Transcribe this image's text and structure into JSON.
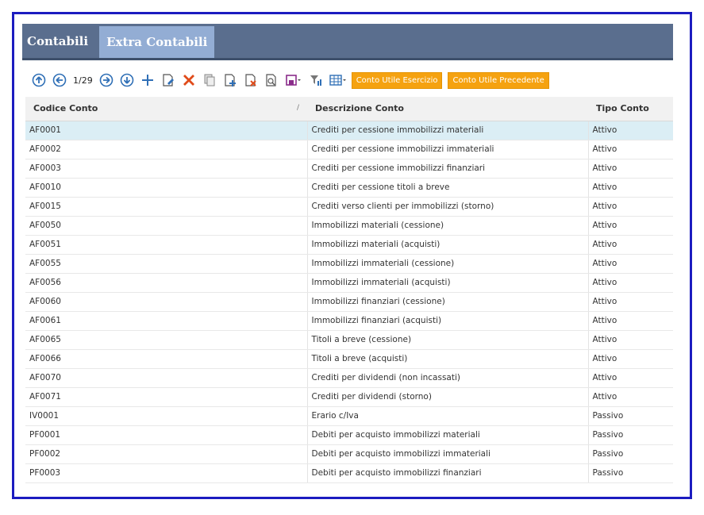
{
  "tabs": [
    {
      "label": "Contabili",
      "selected": false
    },
    {
      "label": "Extra Contabili",
      "selected": true
    }
  ],
  "toolbar": {
    "pager": "1/29",
    "buttons": [
      {
        "name": "first-record-icon"
      },
      {
        "name": "previous-record-icon"
      },
      {
        "name": "next-record-icon"
      },
      {
        "name": "last-record-icon"
      },
      {
        "name": "add-icon"
      },
      {
        "name": "edit-icon"
      },
      {
        "name": "delete-icon"
      },
      {
        "name": "copy-icon"
      },
      {
        "name": "new-document-icon"
      },
      {
        "name": "remove-document-icon"
      },
      {
        "name": "search-document-icon"
      },
      {
        "name": "save-dropdown-icon"
      },
      {
        "name": "filter-icon"
      },
      {
        "name": "grid-view-icon"
      }
    ],
    "action1": "Conto Utile Esercizio",
    "action2": "Conto Utile Precedente"
  },
  "colors": {
    "accent": "#f5a210",
    "tabbar": "#5a6e8e",
    "selected_tab": "#93add4",
    "border": "#1c1cc0"
  },
  "table": {
    "headers": [
      "Codice Conto",
      "Descrizione Conto",
      "Tipo Conto"
    ],
    "rows": [
      [
        "AF0001",
        "Crediti per cessione  immobilizzi materiali",
        "Attivo"
      ],
      [
        "AF0002",
        "Crediti per cessione  immobilizzi immateriali",
        "Attivo"
      ],
      [
        "AF0003",
        "Crediti per cessione  immobilizzi finanziari",
        "Attivo"
      ],
      [
        "AF0010",
        "Crediti per cessione titoli a breve",
        "Attivo"
      ],
      [
        "AF0015",
        "Crediti verso clienti per immobilizzi (storno)",
        "Attivo"
      ],
      [
        "AF0050",
        "Immobilizzi materiali (cessione)",
        "Attivo"
      ],
      [
        "AF0051",
        "Immobilizzi materiali (acquisti)",
        "Attivo"
      ],
      [
        "AF0055",
        "Immobilizzi immateriali (cessione)",
        "Attivo"
      ],
      [
        "AF0056",
        "Immobilizzi immateriali (acquisti)",
        "Attivo"
      ],
      [
        "AF0060",
        "Immobilizzi finanziari (cessione)",
        "Attivo"
      ],
      [
        "AF0061",
        "Immobilizzi finanziari (acquisti)",
        "Attivo"
      ],
      [
        "AF0065",
        "Titoli a breve (cessione)",
        "Attivo"
      ],
      [
        "AF0066",
        "Titoli a breve (acquisti)",
        "Attivo"
      ],
      [
        "AF0070",
        "Crediti per dividendi (non incassati)",
        "Attivo"
      ],
      [
        "AF0071",
        "Crediti per dividendi (storno)",
        "Attivo"
      ],
      [
        "IV0001",
        "Erario c/Iva",
        "Passivo"
      ],
      [
        "PF0001",
        "Debiti per acquisto immobilizzi materiali",
        "Passivo"
      ],
      [
        "PF0002",
        "Debiti per acquisto immobilizzi immateriali",
        "Passivo"
      ],
      [
        "PF0003",
        "Debiti per acquisto immobilizzi finanziari",
        "Passivo"
      ]
    ]
  }
}
